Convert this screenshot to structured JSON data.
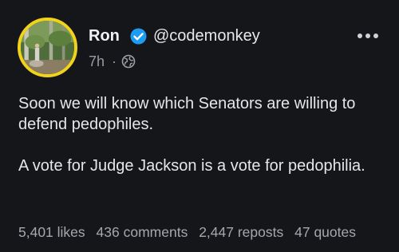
{
  "post": {
    "author": {
      "name": "Ron",
      "handle": "@codemonkey",
      "verified": true
    },
    "timestamp": "7h",
    "separator": "·",
    "visibility_icon": "globe-icon",
    "menu_icon": "more-icon",
    "text": [
      "Soon we will know which Senators are willing to defend pedophiles.",
      "A vote for Judge Jackson is a vote for pedophilia."
    ],
    "stats": {
      "likes": "5,401 likes",
      "comments": "436 comments",
      "reposts": "2,447 reposts",
      "quotes": "47 quotes"
    }
  },
  "colors": {
    "background": "#15161a",
    "avatar_ring": "#f2d21b",
    "verified_badge": "#1d9bf0",
    "muted_text": "#9a9aa2"
  }
}
